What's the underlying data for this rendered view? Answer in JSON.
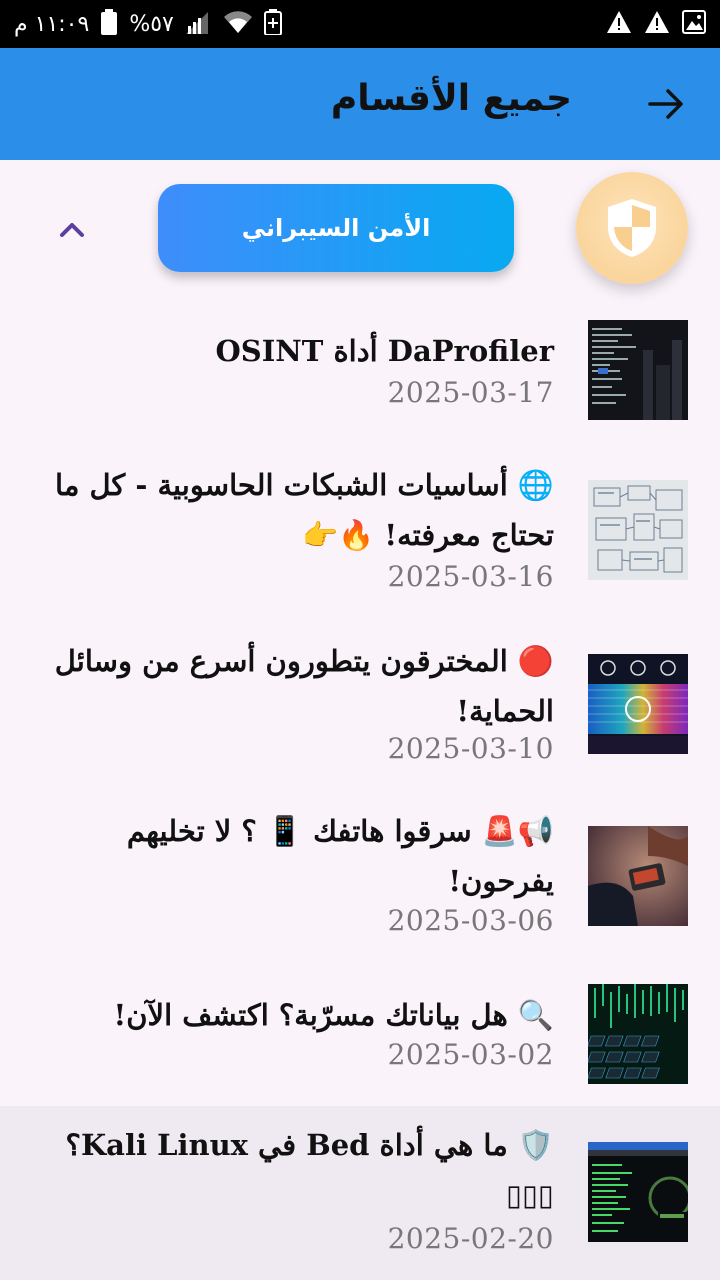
{
  "status_bar": {
    "time": "١١:٠٩ م",
    "battery": "%٥٧"
  },
  "app_bar": {
    "title": "جميع الأقسام"
  },
  "category": {
    "label": "الأمن السيبراني"
  },
  "articles": [
    {
      "title": "DaProfiler أداة OSINT",
      "date": "2025-03-17"
    },
    {
      "title": "🌐 أساسيات الشبكات الحاسوبية - كل ما تحتاج معرفته! 🔥👉",
      "date": "2025-03-16"
    },
    {
      "title": "🔴 المخترقون يتطورون أسرع من وسائل الحماية!",
      "date": "2025-03-10"
    },
    {
      "title": "📢🚨 سرقوا هاتفك 📱 ؟ لا تخليهم يفرحون!",
      "date": "2025-03-06"
    },
    {
      "title": "🔍 هل بياناتك مسرّبة؟ اكتشف الآن!",
      "date": "2025-03-02"
    },
    {
      "title": "🛡️ ما هي أداة Bed في Kali Linux؟ ▯▯▯",
      "date": "2025-02-20"
    }
  ],
  "colors": {
    "app_bar": "#2b8ee8",
    "pill_start": "#3e8dfb",
    "pill_end": "#08a9f1",
    "category_icon_bg": "#f9cf90",
    "date_text": "#777777"
  },
  "icons": {
    "back": "arrow-right-icon",
    "category": "shield-icon",
    "collapse": "chevron-up-icon"
  }
}
